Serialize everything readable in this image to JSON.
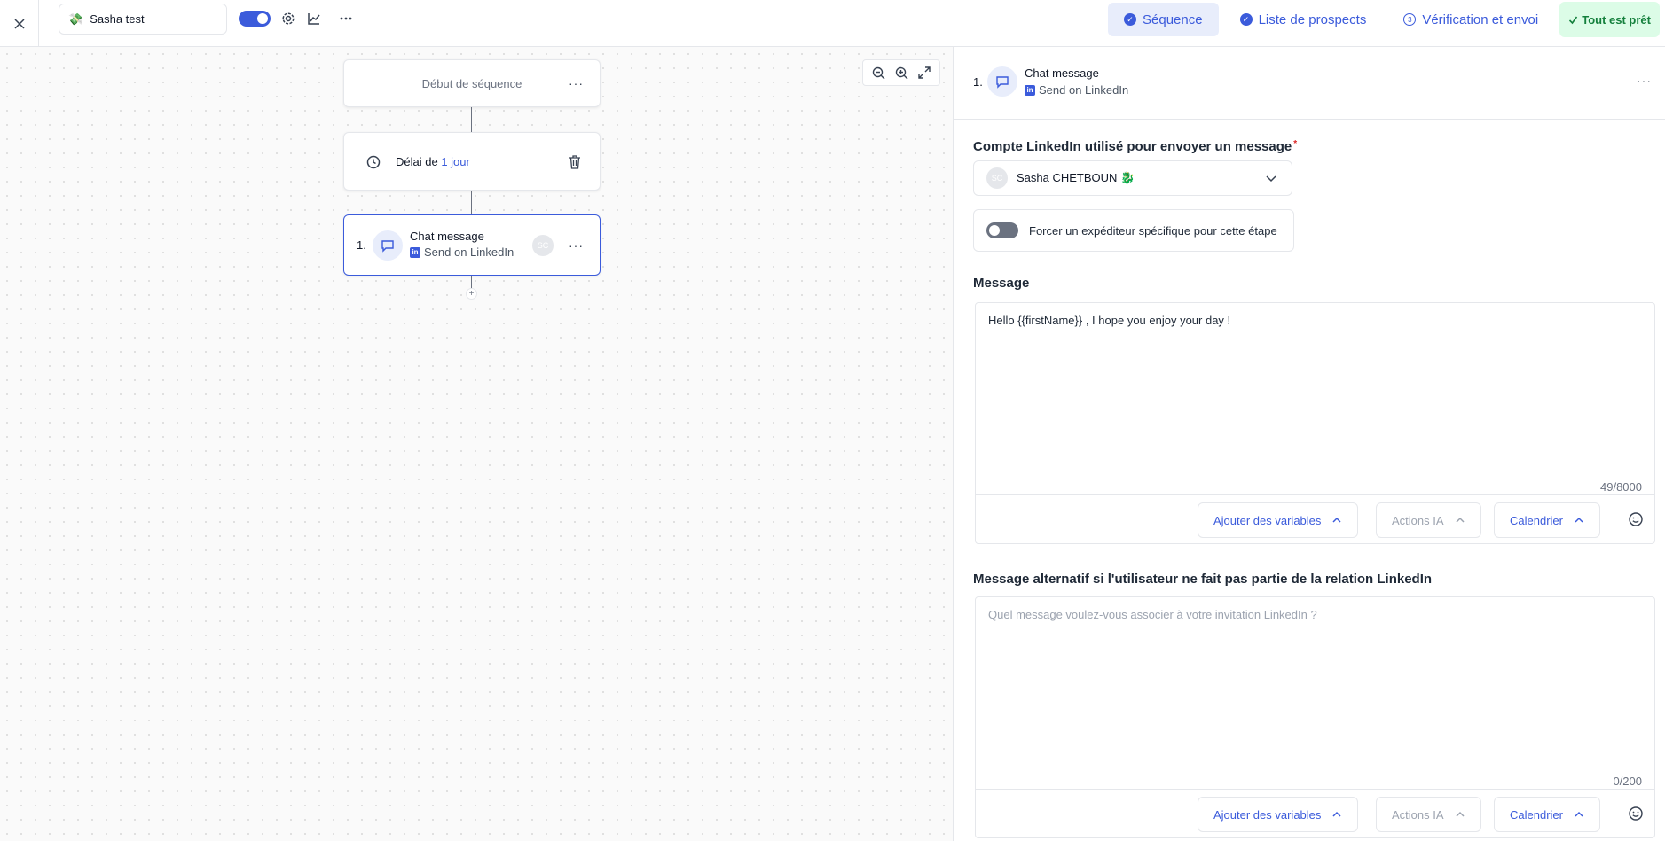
{
  "topbar": {
    "close_icon": "x-icon",
    "sequence_name": "Sasha test",
    "sequence_emoji": "💸",
    "tabs": [
      {
        "label": "Séquence",
        "status": "done"
      },
      {
        "label": "Liste de prospects",
        "status": "done"
      },
      {
        "label": "Vérification et envoi",
        "status": "step",
        "badge": "3"
      }
    ],
    "ready_label": "Tout est prêt",
    "ready_icon": "check-icon"
  },
  "canvas": {
    "start_label": "Début de séquence",
    "delay": {
      "prefix": "Délai de",
      "value": "1 jour"
    },
    "chat_node": {
      "number": "1.",
      "title": "Chat message",
      "subtitle": "Send on LinkedIn",
      "avatar": "SC"
    },
    "add_symbol": "+"
  },
  "panel": {
    "step_number": "1.",
    "title": "Chat message",
    "subtitle": "Send on LinkedIn",
    "account_label": "Compte LinkedIn utilisé pour envoyer un message",
    "required_mark": "*",
    "account": {
      "initials": "SC",
      "name": "Sasha CHETBOUN 🐉"
    },
    "force_sender_label": "Forcer un expéditeur spécifique pour cette étape",
    "message_label": "Message",
    "message_text": "Hello {{firstName}} , I hope you enjoy your day !",
    "message_count": "49/8000",
    "alt_label": "Message alternatif si l'utilisateur ne fait pas partie de la relation LinkedIn",
    "alt_placeholder": "Quel message voulez-vous associer à votre invitation LinkedIn ?",
    "alt_count": "0/200",
    "toolbar": {
      "variables": "Ajouter des variables",
      "ai_actions": "Actions IA",
      "calendar": "Calendrier"
    }
  },
  "colors": {
    "accent": "#3b5bdb",
    "accent_light": "#e8edfb",
    "success_bg": "#dcfce7",
    "success_text": "#15803d"
  }
}
